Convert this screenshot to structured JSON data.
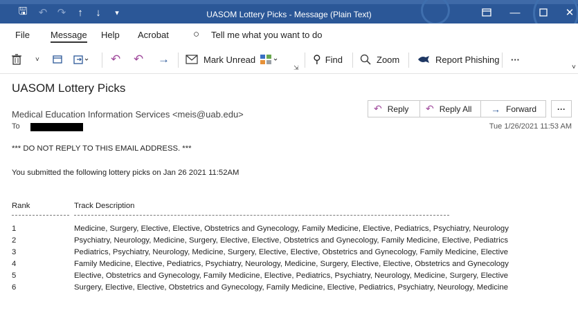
{
  "window": {
    "title": "UASOM Lottery Picks  -  Message (Plain Text)",
    "controls": [
      "restore-icon",
      "minimize-icon",
      "maximize-icon",
      "close-icon"
    ]
  },
  "menu": {
    "items": [
      "File",
      "Message",
      "Help",
      "Acrobat"
    ],
    "active": "Message",
    "tell_me": "Tell me what you want to do"
  },
  "toolbar": {
    "mark_unread": "Mark Unread",
    "find": "Find",
    "zoom": "Zoom",
    "report": "Report Phishing",
    "more": "···"
  },
  "message": {
    "subject": "UASOM Lottery Picks",
    "from": "Medical Education Information Services <meis@uab.edu>",
    "to_label": "To",
    "date": "Tue 1/26/2021 11:53 AM",
    "actions": {
      "reply": "Reply",
      "reply_all": "Reply All",
      "forward": "Forward",
      "more": "···"
    }
  },
  "body": {
    "notice": "*** DO NOT REPLY TO THIS EMAIL ADDRESS. ***",
    "intro": "You submitted the following lottery picks on Jan 26 2021 11:52AM",
    "headers": {
      "rank": "Rank",
      "track": "Track Description"
    },
    "rows": [
      {
        "rank": "1",
        "track": "Medicine, Surgery,  Elective, Elective, Obstetrics and Gynecology, Family Medicine, Elective, Pediatrics, Psychiatry, Neurology"
      },
      {
        "rank": "2",
        "track": "Psychiatry, Neurology, Medicine, Surgery,  Elective, Elective, Obstetrics and Gynecology, Family Medicine, Elective, Pediatrics"
      },
      {
        "rank": "3",
        "track": "Pediatrics, Psychiatry, Neurology, Medicine, Surgery,  Elective, Elective, Obstetrics and Gynecology, Family Medicine, Elective"
      },
      {
        "rank": "4",
        "track": "Family Medicine, Elective, Pediatrics, Psychiatry, Neurology, Medicine, Surgery,  Elective, Elective, Obstetrics and Gynecology"
      },
      {
        "rank": "5",
        "track": "Elective, Obstetrics and Gynecology, Family Medicine, Elective, Pediatrics, Psychiatry, Neurology, Medicine, Surgery,  Elective"
      },
      {
        "rank": "6",
        "track": "Surgery,  Elective, Elective, Obstetrics and Gynecology, Family Medicine, Elective, Pediatrics, Psychiatry, Neurology, Medicine"
      }
    ]
  },
  "colors": {
    "titlebar": "#2b5797",
    "accent": "#2b5797"
  }
}
